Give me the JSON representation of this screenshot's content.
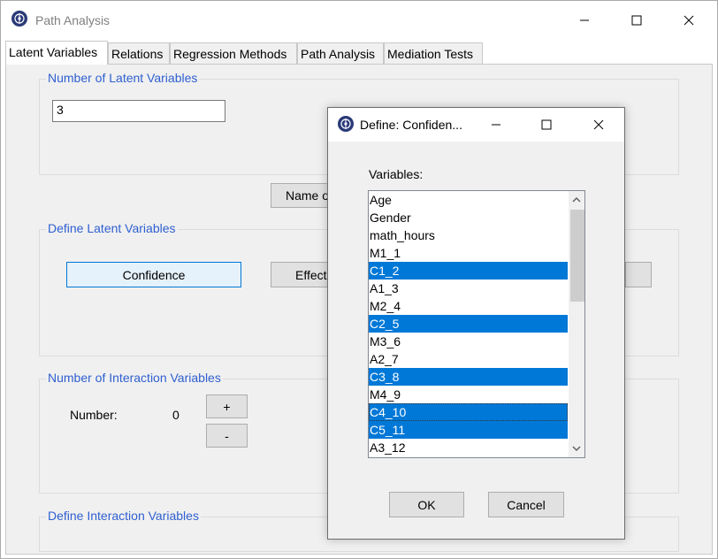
{
  "window": {
    "title": "Path Analysis",
    "minimize": "—",
    "maximize": "☐",
    "close": "✕"
  },
  "tabs": [
    {
      "label": "Latent Variables",
      "active": true
    },
    {
      "label": "Relations"
    },
    {
      "label": "Regression Methods"
    },
    {
      "label": "Path Analysis"
    },
    {
      "label": "Mediation Tests"
    }
  ],
  "latent": {
    "group_label": "Number of Latent Variables",
    "count_value": "3",
    "name_button": "Name o"
  },
  "define_latent": {
    "group_label": "Define Latent Variables",
    "buttons": [
      "Confidence",
      "Effect"
    ]
  },
  "interaction": {
    "group_label": "Number of Interaction Variables",
    "number_label": "Number:",
    "number_value": "0",
    "plus": "+",
    "minus": "-"
  },
  "define_interaction": {
    "group_label": "Define Interaction Variables"
  },
  "dialog": {
    "title": "Define: Confiden...",
    "minimize": "—",
    "maximize": "☐",
    "close": "✕",
    "variables_label": "Variables:",
    "items": [
      {
        "label": "Age",
        "selected": false
      },
      {
        "label": "Gender",
        "selected": false
      },
      {
        "label": "math_hours",
        "selected": false
      },
      {
        "label": "M1_1",
        "selected": false
      },
      {
        "label": "C1_2",
        "selected": true
      },
      {
        "label": "A1_3",
        "selected": false
      },
      {
        "label": "M2_4",
        "selected": false
      },
      {
        "label": "C2_5",
        "selected": true
      },
      {
        "label": "M3_6",
        "selected": false
      },
      {
        "label": "A2_7",
        "selected": false
      },
      {
        "label": "C3_8",
        "selected": true
      },
      {
        "label": "M4_9",
        "selected": false
      },
      {
        "label": "C4_10",
        "selected": true,
        "focused": true
      },
      {
        "label": "C5_11",
        "selected": true
      },
      {
        "label": "A3_12",
        "selected": false
      }
    ],
    "scroll_up": "⌃",
    "scroll_down": "⌄",
    "ok": "OK",
    "cancel": "Cancel"
  }
}
